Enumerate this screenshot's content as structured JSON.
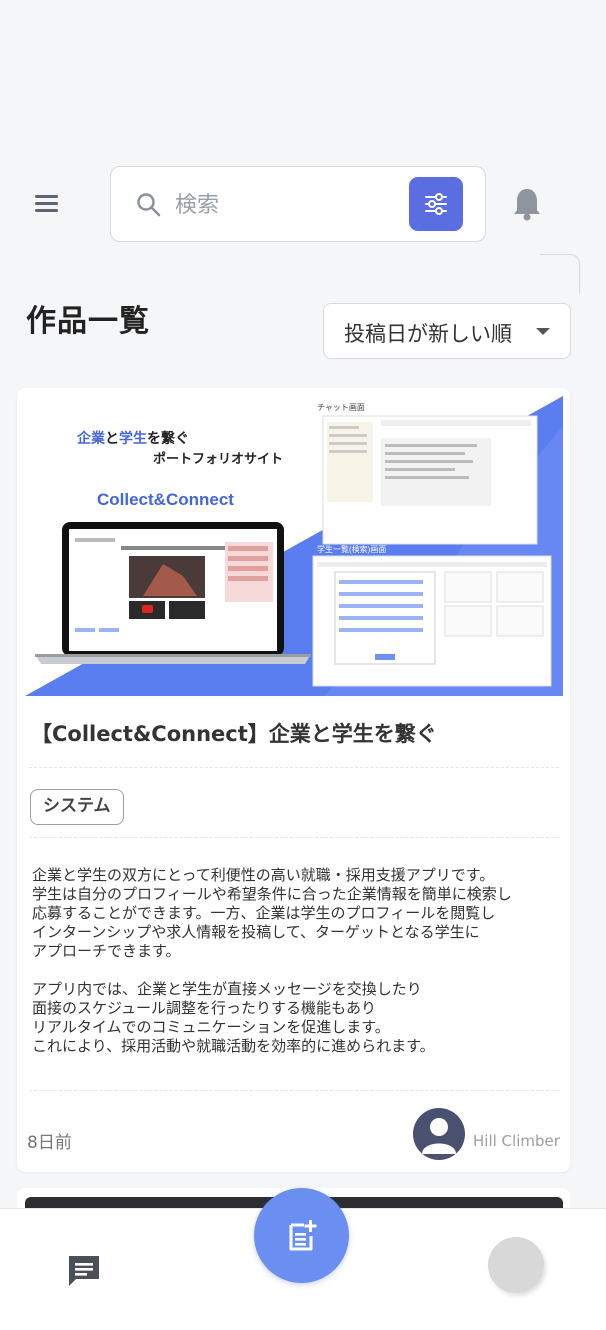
{
  "header": {
    "search_placeholder": "検索",
    "icons": {
      "menu": "menu-icon",
      "search": "search-icon",
      "filter": "sliders-icon",
      "bell": "bell-icon"
    }
  },
  "page": {
    "title": "作品一覧",
    "sort_selected": "投稿日が新しい順"
  },
  "card": {
    "thumbnail": {
      "headline_parts": [
        "企業",
        "と",
        "学生",
        "を繋ぐ"
      ],
      "subheadline": "ポートフォリオサイト",
      "brand": "Collect&Connect",
      "chat_screen_label": "チャット画面",
      "student_search_label": "学生一覧(検索)画面"
    },
    "title": "【Collect&Connect】企業と学生を繋ぐ",
    "tag": "システム",
    "description": "企業と学生の双方にとって利便性の高い就職・採用支援アプリです。\n学生は自分のプロフィールや希望条件に合った企業情報を簡単に検索し\n応募することができます。一方、企業は学生のプロフィールを閲覧し\nインターンシップや求人情報を投稿して、ターゲットとなる学生に\nアプローチできます。\n\nアプリ内では、企業と学生が直接メッセージを交換したり\n面接のスケジュール調整を行ったりする機能もあり\nリアルタイムでのコミュニケーションを促進します。\nこれにより、採用活動や就職活動を効率的に進められます。",
    "posted": "8日前",
    "author": "Hill Climber"
  },
  "bottom_nav": {
    "icons": {
      "chat": "chat-icon",
      "new_post": "new-post-icon",
      "user": "user-avatar"
    }
  },
  "colors": {
    "accent": "#5b6ee1",
    "fab": "#6a8ff0",
    "thumb_blue": "#5a7ef0",
    "headline_blue": "#4466dd"
  }
}
